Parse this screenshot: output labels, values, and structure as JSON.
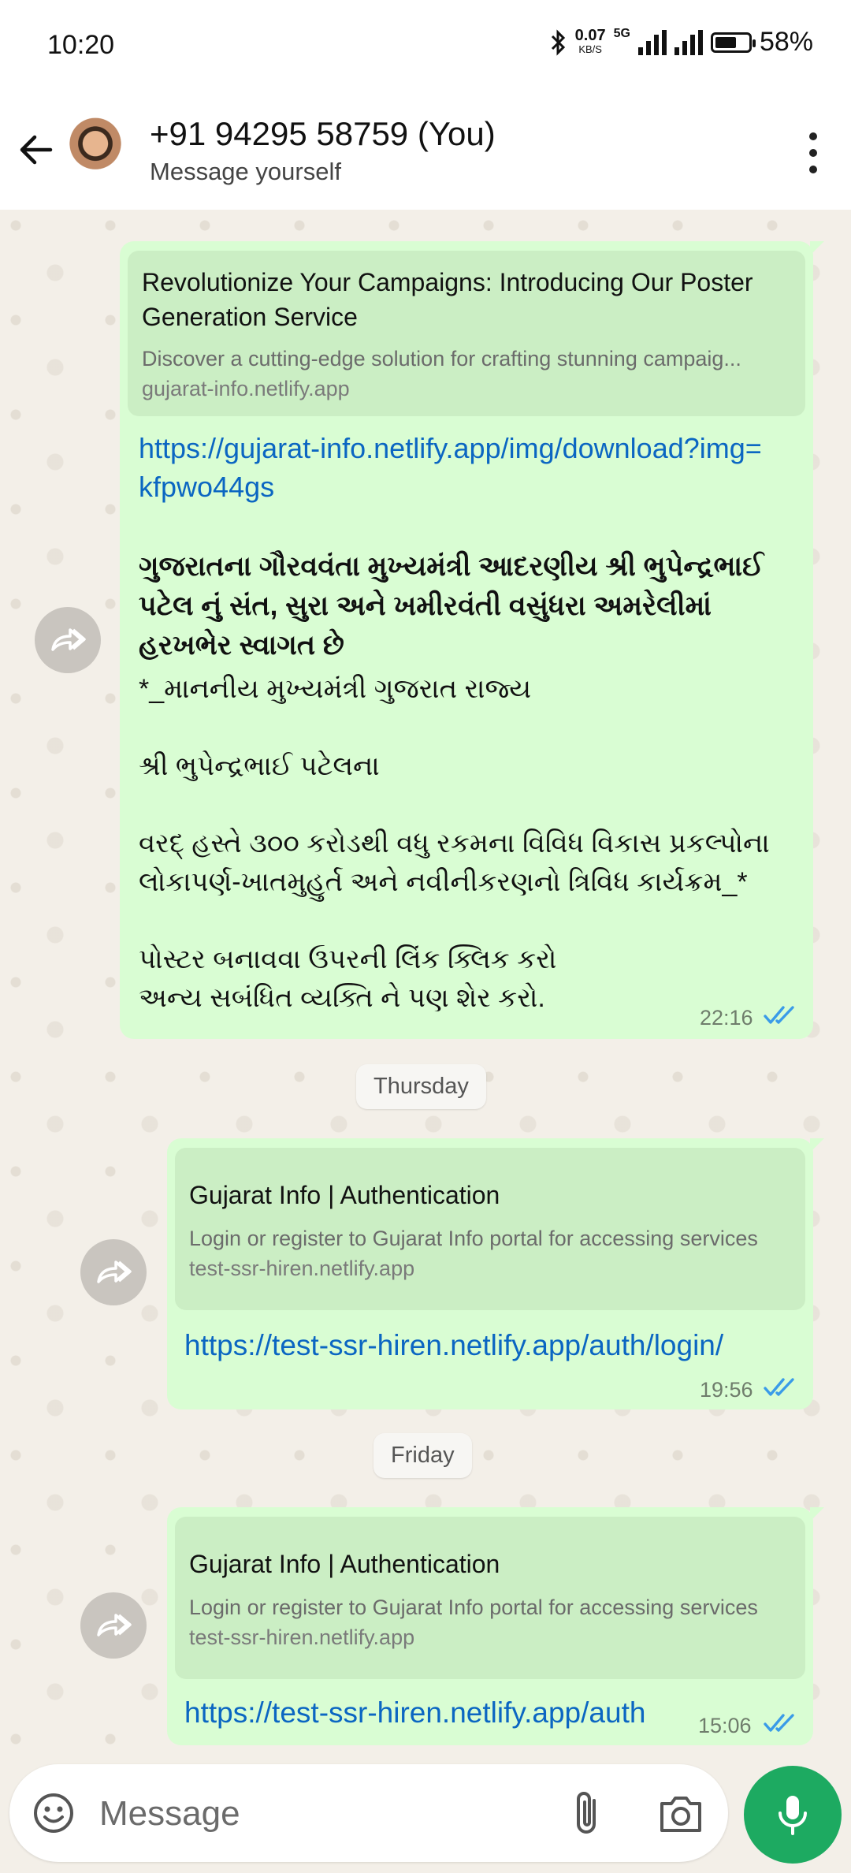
{
  "status_bar": {
    "time": "10:20",
    "net_speed": "0.07",
    "net_unit": "KB/S",
    "network": "5G",
    "battery": "58%"
  },
  "header": {
    "contact_name": "+91 94295 58759 (You)",
    "subtitle": "Message yourself"
  },
  "messages": [
    {
      "preview_title": "Revolutionize Your Campaigns: Introducing Our Poster Generation Service",
      "preview_desc": "Discover a cutting-edge solution for crafting stunning campaig...",
      "preview_domain": "gujarat-info.netlify.app",
      "link": "https://gujarat-info.netlify.app/img/download?img=kfpwo44gs",
      "bold_text": "ગુજરાતના ગૌરવવંતા મુખ્યમંત્રી આદરણીય  શ્રી ભુપેન્દ્રભાઈ પટેલ  નું સંત, સુરા અને ખમીરવંતી વસુંધરા અમરેલીમાં હરખભેર સ્વાગત છે",
      "body_text": "*_માનનીય મુખ્યમંત્રી ગુજરાત રાજ્ય\n\nશ્રી ભુપેન્દ્રભાઈ પટેલના\n\nવરદ્ હસ્તે ૩૦૦ કરોડથી વધુ રકમના વિવિધ વિકાસ પ્રકલ્પોના લોકાપર્ણ-ખાતમુહુર્ત અને નવીનીકરણનો ત્રિવિધ કાર્યક્રમ_*\n\nપોસ્ટર બનાવવા ઉપરની લિંક ક્લિક કરો\nઅન્ય સબંધિત વ્યક્તિ ને પણ શેર કરો.",
      "time": "22:16"
    },
    {
      "date_label": "Thursday",
      "preview_title": "Gujarat Info | Authentication",
      "preview_desc": "Login or register to Gujarat Info portal for accessing services",
      "preview_domain": "test-ssr-hiren.netlify.app",
      "link": "https://test-ssr-hiren.netlify.app/auth/login/",
      "time": "19:56"
    },
    {
      "date_label": "Friday",
      "preview_title": "Gujarat Info | Authentication",
      "preview_desc": "Login or register to Gujarat Info portal for accessing services",
      "preview_domain": "test-ssr-hiren.netlify.app",
      "link": "https://test-ssr-hiren.netlify.app/auth",
      "time": "15:06"
    }
  ],
  "input": {
    "placeholder": "Message"
  },
  "colors": {
    "bubble": "#d9fdd3",
    "link": "#0b66c2",
    "read_ticks": "#3a9be8",
    "mic_button": "#1daa61"
  }
}
